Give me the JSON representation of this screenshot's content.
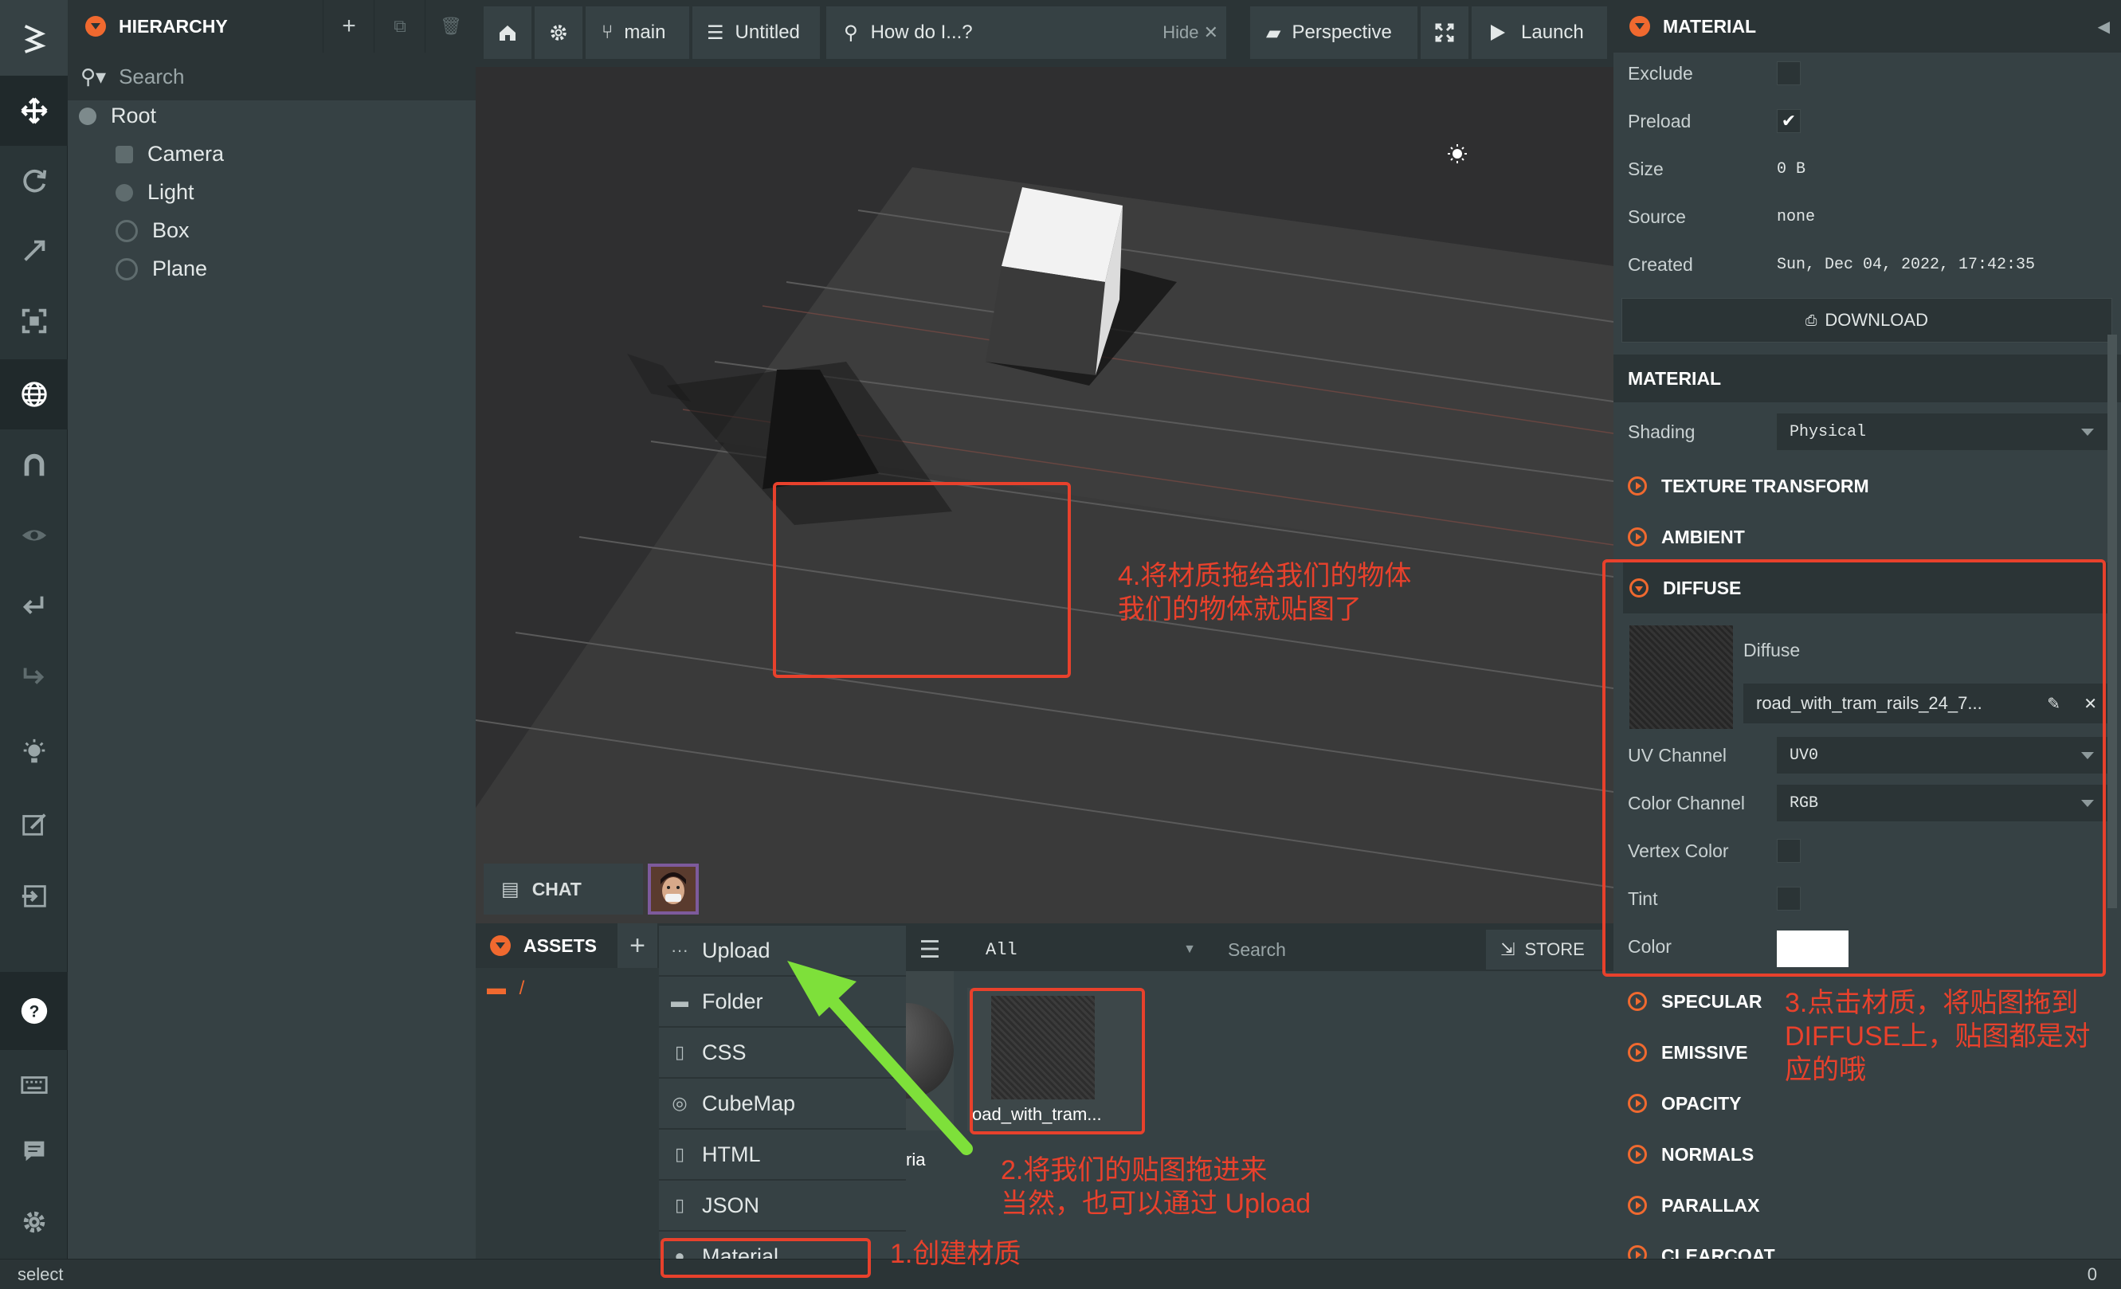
{
  "hierarchy": {
    "title": "HIERARCHY",
    "search_placeholder": "Search",
    "items": [
      "Root",
      "Camera",
      "Light",
      "Box",
      "Plane"
    ]
  },
  "topbar": {
    "branch": "main",
    "project": "Untitled",
    "help_query": "How do I...?",
    "hide_label": "Hide",
    "camera": "Perspective",
    "launch": "Launch"
  },
  "chat": {
    "label": "CHAT"
  },
  "assets": {
    "title": "ASSETS",
    "folder_path": "/",
    "filter": "All",
    "search_placeholder": "Search",
    "store": "STORE",
    "menu": [
      "Upload",
      "Folder",
      "CSS",
      "CubeMap",
      "HTML",
      "JSON",
      "Material"
    ],
    "thumb_partial": "ria",
    "texture_name": "oad_with_tram..."
  },
  "inspector": {
    "title": "MATERIAL",
    "exclude": "Exclude",
    "preload": "Preload",
    "size_label": "Size",
    "size_value": "0 B",
    "source_label": "Source",
    "source_value": "none",
    "created_label": "Created",
    "created_value": "Sun, Dec 04, 2022, 17:42:35",
    "download": "DOWNLOAD",
    "material_section": "MATERIAL",
    "shading_label": "Shading",
    "shading_value": "Physical",
    "sections_top": [
      "TEXTURE TRANSFORM",
      "AMBIENT"
    ],
    "diffuse": {
      "title": "DIFFUSE",
      "label": "Diffuse",
      "texture": "road_with_tram_rails_24_7...",
      "uv_label": "UV Channel",
      "uv_value": "UV0",
      "color_channel_label": "Color Channel",
      "color_channel_value": "RGB",
      "vertex_color": "Vertex Color",
      "tint": "Tint",
      "color": "Color"
    },
    "sections_bottom": [
      "SPECULAR",
      "EMISSIVE",
      "OPACITY",
      "NORMALS",
      "PARALLAX",
      "CLEARCOAT"
    ]
  },
  "status": {
    "left": "select",
    "right": "0"
  },
  "annotations": {
    "step1": "1.创建材质",
    "step2": "2.将我们的贴图拖进来\n当然，也可以通过 Upload",
    "step3": "3.点击材质，将贴图拖到\nDIFFUSE上，贴图都是对\n应的哦",
    "step4": "4.将材质拖给我们的物体\n我们的物体就贴图了"
  },
  "colors": {
    "accent": "#f0692f",
    "annotation": "#e8412c",
    "arrow": "#7ee03a"
  }
}
